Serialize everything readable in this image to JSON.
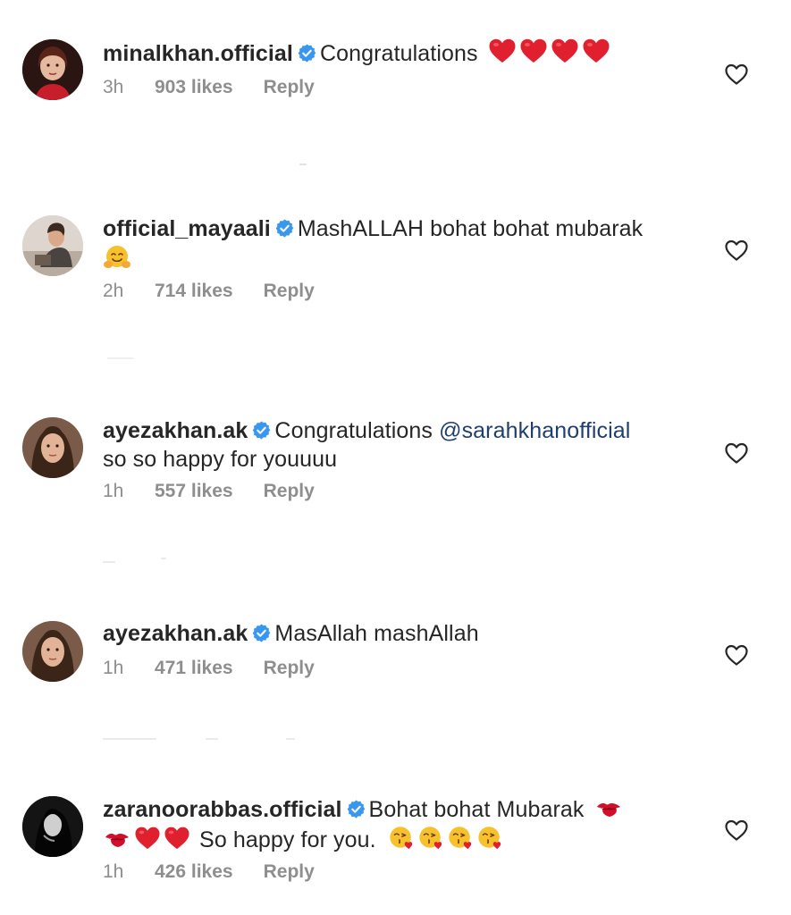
{
  "comments": [
    {
      "username": "minalkhan.official",
      "text": "Congratulations",
      "trailing_emojis": [
        "red-heart",
        "red-heart",
        "red-heart",
        "red-heart"
      ],
      "time": "3h",
      "likes": "903 likes",
      "reply": "Reply"
    },
    {
      "username": "official_mayaali",
      "text": "MashALLAH bohat bohat mubarak",
      "line2_emojis": [
        "hugging-face"
      ],
      "time": "2h",
      "likes": "714 likes",
      "reply": "Reply"
    },
    {
      "username": "ayezakhan.ak",
      "text": "Congratulations",
      "mention": "@sarahkhanofficial",
      "line2_text": "so so happy for youuuu",
      "time": "1h",
      "likes": "557 likes",
      "reply": "Reply"
    },
    {
      "username": "ayezakhan.ak",
      "text": "MasAllah mashAllah",
      "time": "1h",
      "likes": "471 likes",
      "reply": "Reply"
    },
    {
      "username": "zaranoorabbas.official",
      "text": "Bohat bohat Mubarak",
      "line1_emojis": [
        "kiss-mark"
      ],
      "line2_emojis": [
        "kiss-mark",
        "red-heart",
        "red-heart"
      ],
      "line2_text": "So happy for you.",
      "line2_trailing_emojis": [
        "face-blowing-kiss",
        "face-blowing-kiss",
        "face-blowing-kiss",
        "face-blowing-kiss"
      ],
      "time": "1h",
      "likes": "426 likes",
      "reply": "Reply"
    }
  ],
  "colors": {
    "username": "#262626",
    "meta": "#8e8e8e",
    "verified": "#3897f0",
    "mention": "#1f3f6e",
    "heart_emoji": "#e0202e"
  },
  "icons": {
    "verified": "verified-badge-icon",
    "like": "heart-outline-icon"
  }
}
